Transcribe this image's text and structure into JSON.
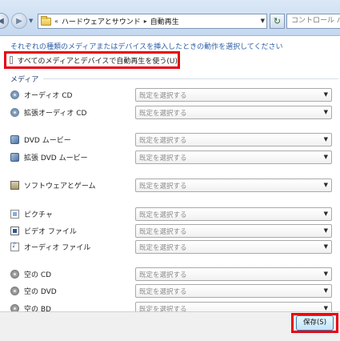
{
  "address_bar": {
    "back_icon": "arrow-left-icon",
    "forward_icon": "arrow-right-icon",
    "breadcrumb_prefix": "«",
    "breadcrumb": [
      "ハードウェアとサウンド",
      "自動再生"
    ],
    "refresh_icon": "refresh-icon",
    "search_placeholder": "コントロール パネ"
  },
  "intro_text": "それぞれの種類のメディアまたはデバイスを挿入したときの動作を選択してください",
  "autoplay_checkbox": {
    "label": "すべてのメディアとデバイスで自動再生を使う(U)",
    "checked": false
  },
  "section_media": "メディア",
  "select_placeholder": "既定を選択する",
  "media_items": [
    {
      "label": "オーディオ CD",
      "icon": "audio-cd-icon",
      "value": "既定を選択する"
    },
    {
      "label": "拡張オーディオ CD",
      "icon": "enhanced-audio-cd-icon",
      "value": "既定を選択する"
    },
    {
      "label": "DVD ムービー",
      "icon": "dvd-movie-icon",
      "value": "既定を選択する"
    },
    {
      "label": "拡張 DVD ムービー",
      "icon": "enhanced-dvd-movie-icon",
      "value": "既定を選択する"
    },
    {
      "label": "ソフトウェアとゲーム",
      "icon": "software-games-icon",
      "value": "既定を選択する"
    },
    {
      "label": "ピクチャ",
      "icon": "picture-icon",
      "value": "既定を選択する"
    },
    {
      "label": "ビデオ ファイル",
      "icon": "video-file-icon",
      "value": "既定を選択する"
    },
    {
      "label": "オーディオ ファイル",
      "icon": "audio-file-icon",
      "value": "既定を選択する"
    },
    {
      "label": "空の CD",
      "icon": "blank-cd-icon",
      "value": "既定を選択する"
    },
    {
      "label": "空の DVD",
      "icon": "blank-dvd-icon",
      "value": "既定を選択する"
    },
    {
      "label": "空の BD",
      "icon": "blank-bd-icon",
      "value": "既定を選択する"
    }
  ],
  "save_button": "保存(S)",
  "colors": {
    "highlight": "#e8000e",
    "link": "#2d5ea8"
  }
}
